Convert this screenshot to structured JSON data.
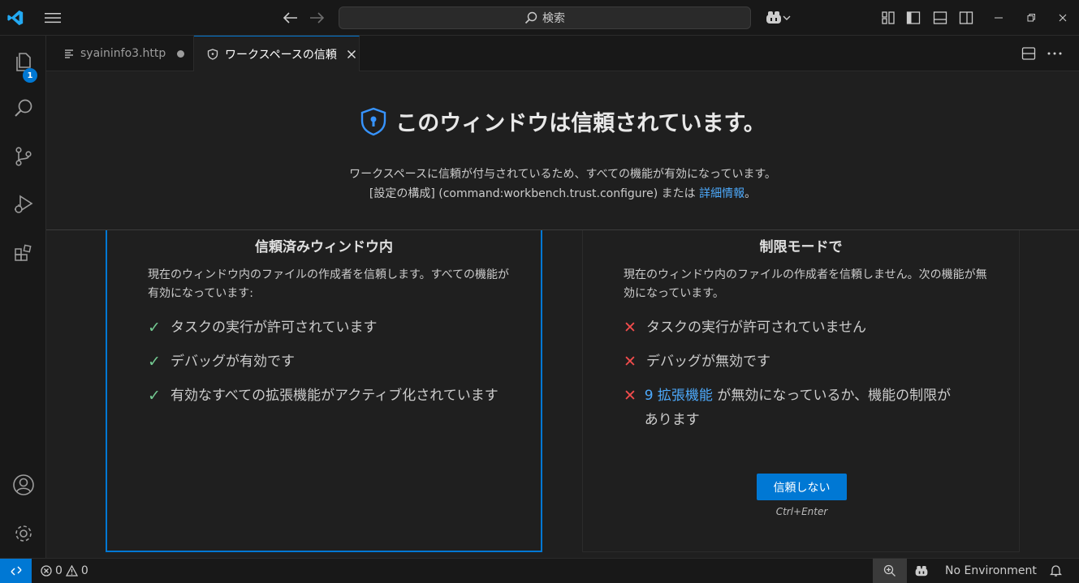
{
  "titlebar": {
    "search_placeholder": "検索"
  },
  "activity": {
    "explorer_badge": "1"
  },
  "tabs": [
    {
      "label": "syaininfo3.http"
    },
    {
      "label": "ワークスペースの信頼"
    }
  ],
  "trust": {
    "title": "このウィンドウは信頼されています。",
    "line1": "ワークスペースに信頼が付与されているため、すべての機能が有効になっています。",
    "line2_prefix": "[設定の構成] (command:workbench.trust.configure) または ",
    "line2_link": "詳細情報",
    "line2_suffix": "。"
  },
  "trusted_card": {
    "title": "信頼済みウィンドウ内",
    "desc": "現在のウィンドウ内のファイルの作成者を信頼します。すべての機能が有効になっています:",
    "features": [
      "タスクの実行が許可されています",
      "デバッグが有効です",
      "有効なすべての拡張機能がアクティブ化されています"
    ]
  },
  "restricted_card": {
    "title": "制限モードで",
    "desc": "現在のウィンドウ内のファイルの作成者を信頼しません。次の機能が無効になっています。",
    "features": [
      "タスクの実行が許可されていません",
      "デバッグが無効です"
    ],
    "ext_link": "9 拡張機能",
    "ext_text": " が無効になっているか、機能の制限があります",
    "button": "信頼しない",
    "shortcut": "Ctrl+Enter"
  },
  "status": {
    "errors": "0",
    "warnings": "0",
    "environment": "No Environment"
  },
  "colors": {
    "accent": "#0078d4",
    "check": "#73c991",
    "cross": "#f14c4c",
    "link": "#4daafc"
  }
}
